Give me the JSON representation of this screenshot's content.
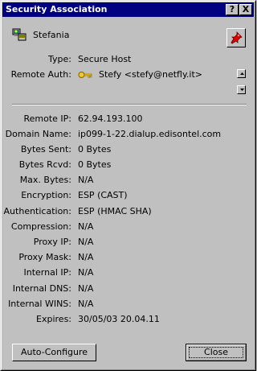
{
  "window": {
    "title": "Security Association",
    "help_button": "?",
    "close_button": "X"
  },
  "user": {
    "name": "Stefania",
    "icon": "user-computer-icon"
  },
  "pin": {
    "icon": "pushpin-icon"
  },
  "fields_top": [
    {
      "label": "Type:",
      "value": "Secure Host"
    }
  ],
  "remote_auth": {
    "label": "Remote Auth:",
    "icon": "key-icon",
    "value": "Stefy <stefy@netfly.it>"
  },
  "details": [
    {
      "label": "Remote IP:",
      "value": "62.94.193.100"
    },
    {
      "label": "Domain Name:",
      "value": "ip099-1-22.dialup.edisontel.com"
    },
    {
      "label": "Bytes Sent:",
      "value": "0 Bytes"
    },
    {
      "label": "Bytes Rcvd:",
      "value": "0 Bytes"
    },
    {
      "label": "Max. Bytes:",
      "value": "N/A"
    },
    {
      "label": "Encryption:",
      "value": "ESP (CAST)"
    },
    {
      "label": "Authentication:",
      "value": "ESP (HMAC SHA)"
    },
    {
      "label": "Compression:",
      "value": "N/A"
    },
    {
      "label": "Proxy IP:",
      "value": "N/A"
    },
    {
      "label": "Proxy Mask:",
      "value": "N/A"
    },
    {
      "label": "Internal IP:",
      "value": "N/A"
    },
    {
      "label": "Internal DNS:",
      "value": "N/A"
    },
    {
      "label": "Internal WINS:",
      "value": "N/A"
    },
    {
      "label": "Expires:",
      "value": "30/05/03 20.04.11"
    }
  ],
  "buttons": {
    "auto_configure": "Auto-Configure",
    "close": "Close"
  },
  "colors": {
    "face": "#c0c0c0",
    "titlebar": "#000080"
  }
}
